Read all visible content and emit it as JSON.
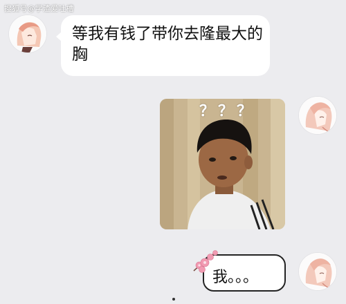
{
  "watermark": {
    "text": "搜狐号@学渣爱吐槽"
  },
  "messages": [
    {
      "side": "left",
      "avatar_icon": "anime-girl-avatar-icon",
      "text": "等我有钱了带你去隆最大的胸"
    },
    {
      "side": "right",
      "avatar_icon": "anime-girl-avatar-icon",
      "image": "confused-boy-meme-image",
      "overlay_text": "？？？"
    },
    {
      "side": "right",
      "avatar_icon": "anime-girl-avatar-icon",
      "decoration_icon": "pink-flower-icon",
      "text": "我。。。"
    }
  ],
  "colors": {
    "background": "#ececef",
    "bubble": "#ffffff",
    "text": "#111111"
  }
}
